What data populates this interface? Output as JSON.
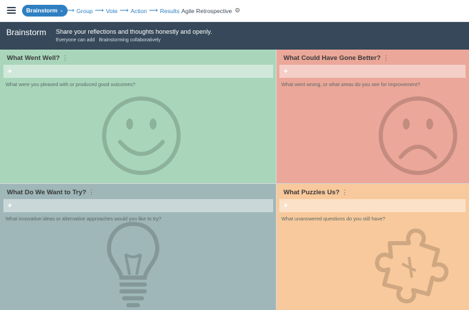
{
  "toolbar": {
    "menu_icon": "hamburger-icon",
    "current_step": "Brainstorm",
    "steps": [
      "Group",
      "Vote",
      "Action",
      "Results"
    ],
    "retro_title": "Agile Retrospective",
    "settings_icon": "gear-icon"
  },
  "banner": {
    "title": "Brainstorm",
    "description": "Share your reflections and thoughts honestly and openly.",
    "status": [
      "Everyone can add",
      "Brainstorming collaboratively"
    ]
  },
  "quadrants": [
    {
      "title": "What Went Well?",
      "more": "⋮",
      "prompt": "What were you pleased with or produced good outcomes?",
      "icon": "smiley-face-icon",
      "color": "#a9d6bb"
    },
    {
      "title": "What Could Have Gone Better?",
      "more": "⋮",
      "prompt": "What went wrong, or what areas do you see for improvement?",
      "icon": "sad-face-icon",
      "color": "#eba799"
    },
    {
      "title": "What Do We Want to Try?",
      "more": "⋮",
      "prompt": "What innovative ideas or alternative approaches would you like to try?",
      "icon": "lightbulb-icon",
      "color": "#9fb7b8"
    },
    {
      "title": "What Puzzles Us?",
      "more": "⋮",
      "prompt": "What unanswered questions do you still have?",
      "icon": "puzzle-piece-icon",
      "color": "#f8c99c"
    }
  ],
  "add_symbol": "+",
  "step_arrow": "⟶",
  "chevron": "⌄",
  "gear_glyph": "⚙"
}
